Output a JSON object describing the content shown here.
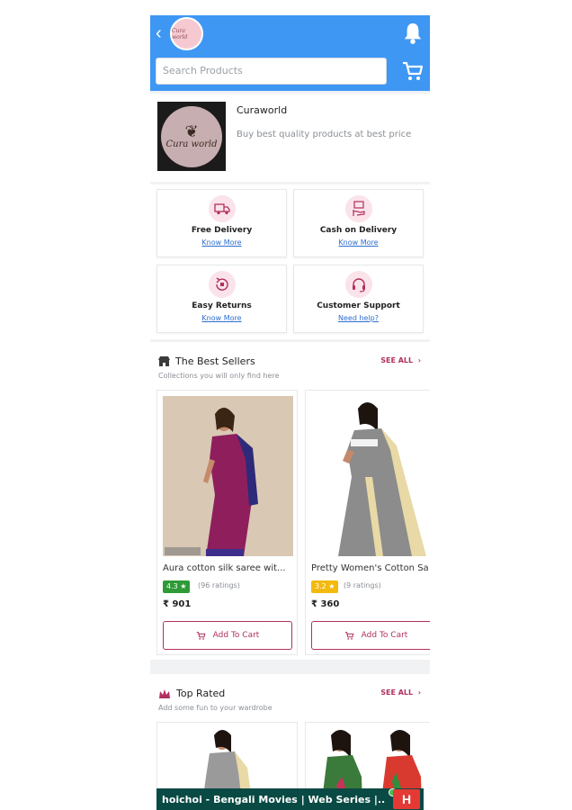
{
  "header": {
    "logo_text": "Cura world",
    "search_placeholder": "Search Products"
  },
  "store": {
    "logo_text": "Cura world",
    "name": "Curaworld",
    "tagline": "Buy best quality products at best price"
  },
  "features": [
    {
      "title": "Free Delivery",
      "link": "Know More",
      "icon": "truck-icon"
    },
    {
      "title": "Cash on Delivery",
      "link": "Know More",
      "icon": "cash-hand-icon"
    },
    {
      "title": "Easy Returns",
      "link": "Know More",
      "icon": "return-icon"
    },
    {
      "title": "Customer Support",
      "link": "Need help?",
      "icon": "headset-icon"
    }
  ],
  "best_sellers": {
    "title": "The Best Sellers",
    "subtitle": "Collections you will only find here",
    "see_all": "SEE ALL",
    "products": [
      {
        "name": "Aura cotton silk saree wit...",
        "rating": "4.3 ★",
        "ratings_count": "(96 ratings)",
        "price": "₹ 901",
        "add_label": "Add To Cart",
        "rating_color": "#2e9b36"
      },
      {
        "name": "Pretty Women's Cotton Sa",
        "rating": "3.2 ★",
        "ratings_count": "(9 ratings)",
        "price": "₹ 360",
        "add_label": "Add To Cart",
        "rating_color": "#f2b90f"
      }
    ]
  },
  "top_rated": {
    "title": "Top Rated",
    "subtitle": "Add some fun to your wardrobe",
    "see_all": "SEE ALL"
  },
  "ad": {
    "text": "hoichoi - Bengali Movies | Web Series |...",
    "logo": "H"
  },
  "colors": {
    "header_blue": "#3f97f4",
    "accent": "#b03060"
  }
}
